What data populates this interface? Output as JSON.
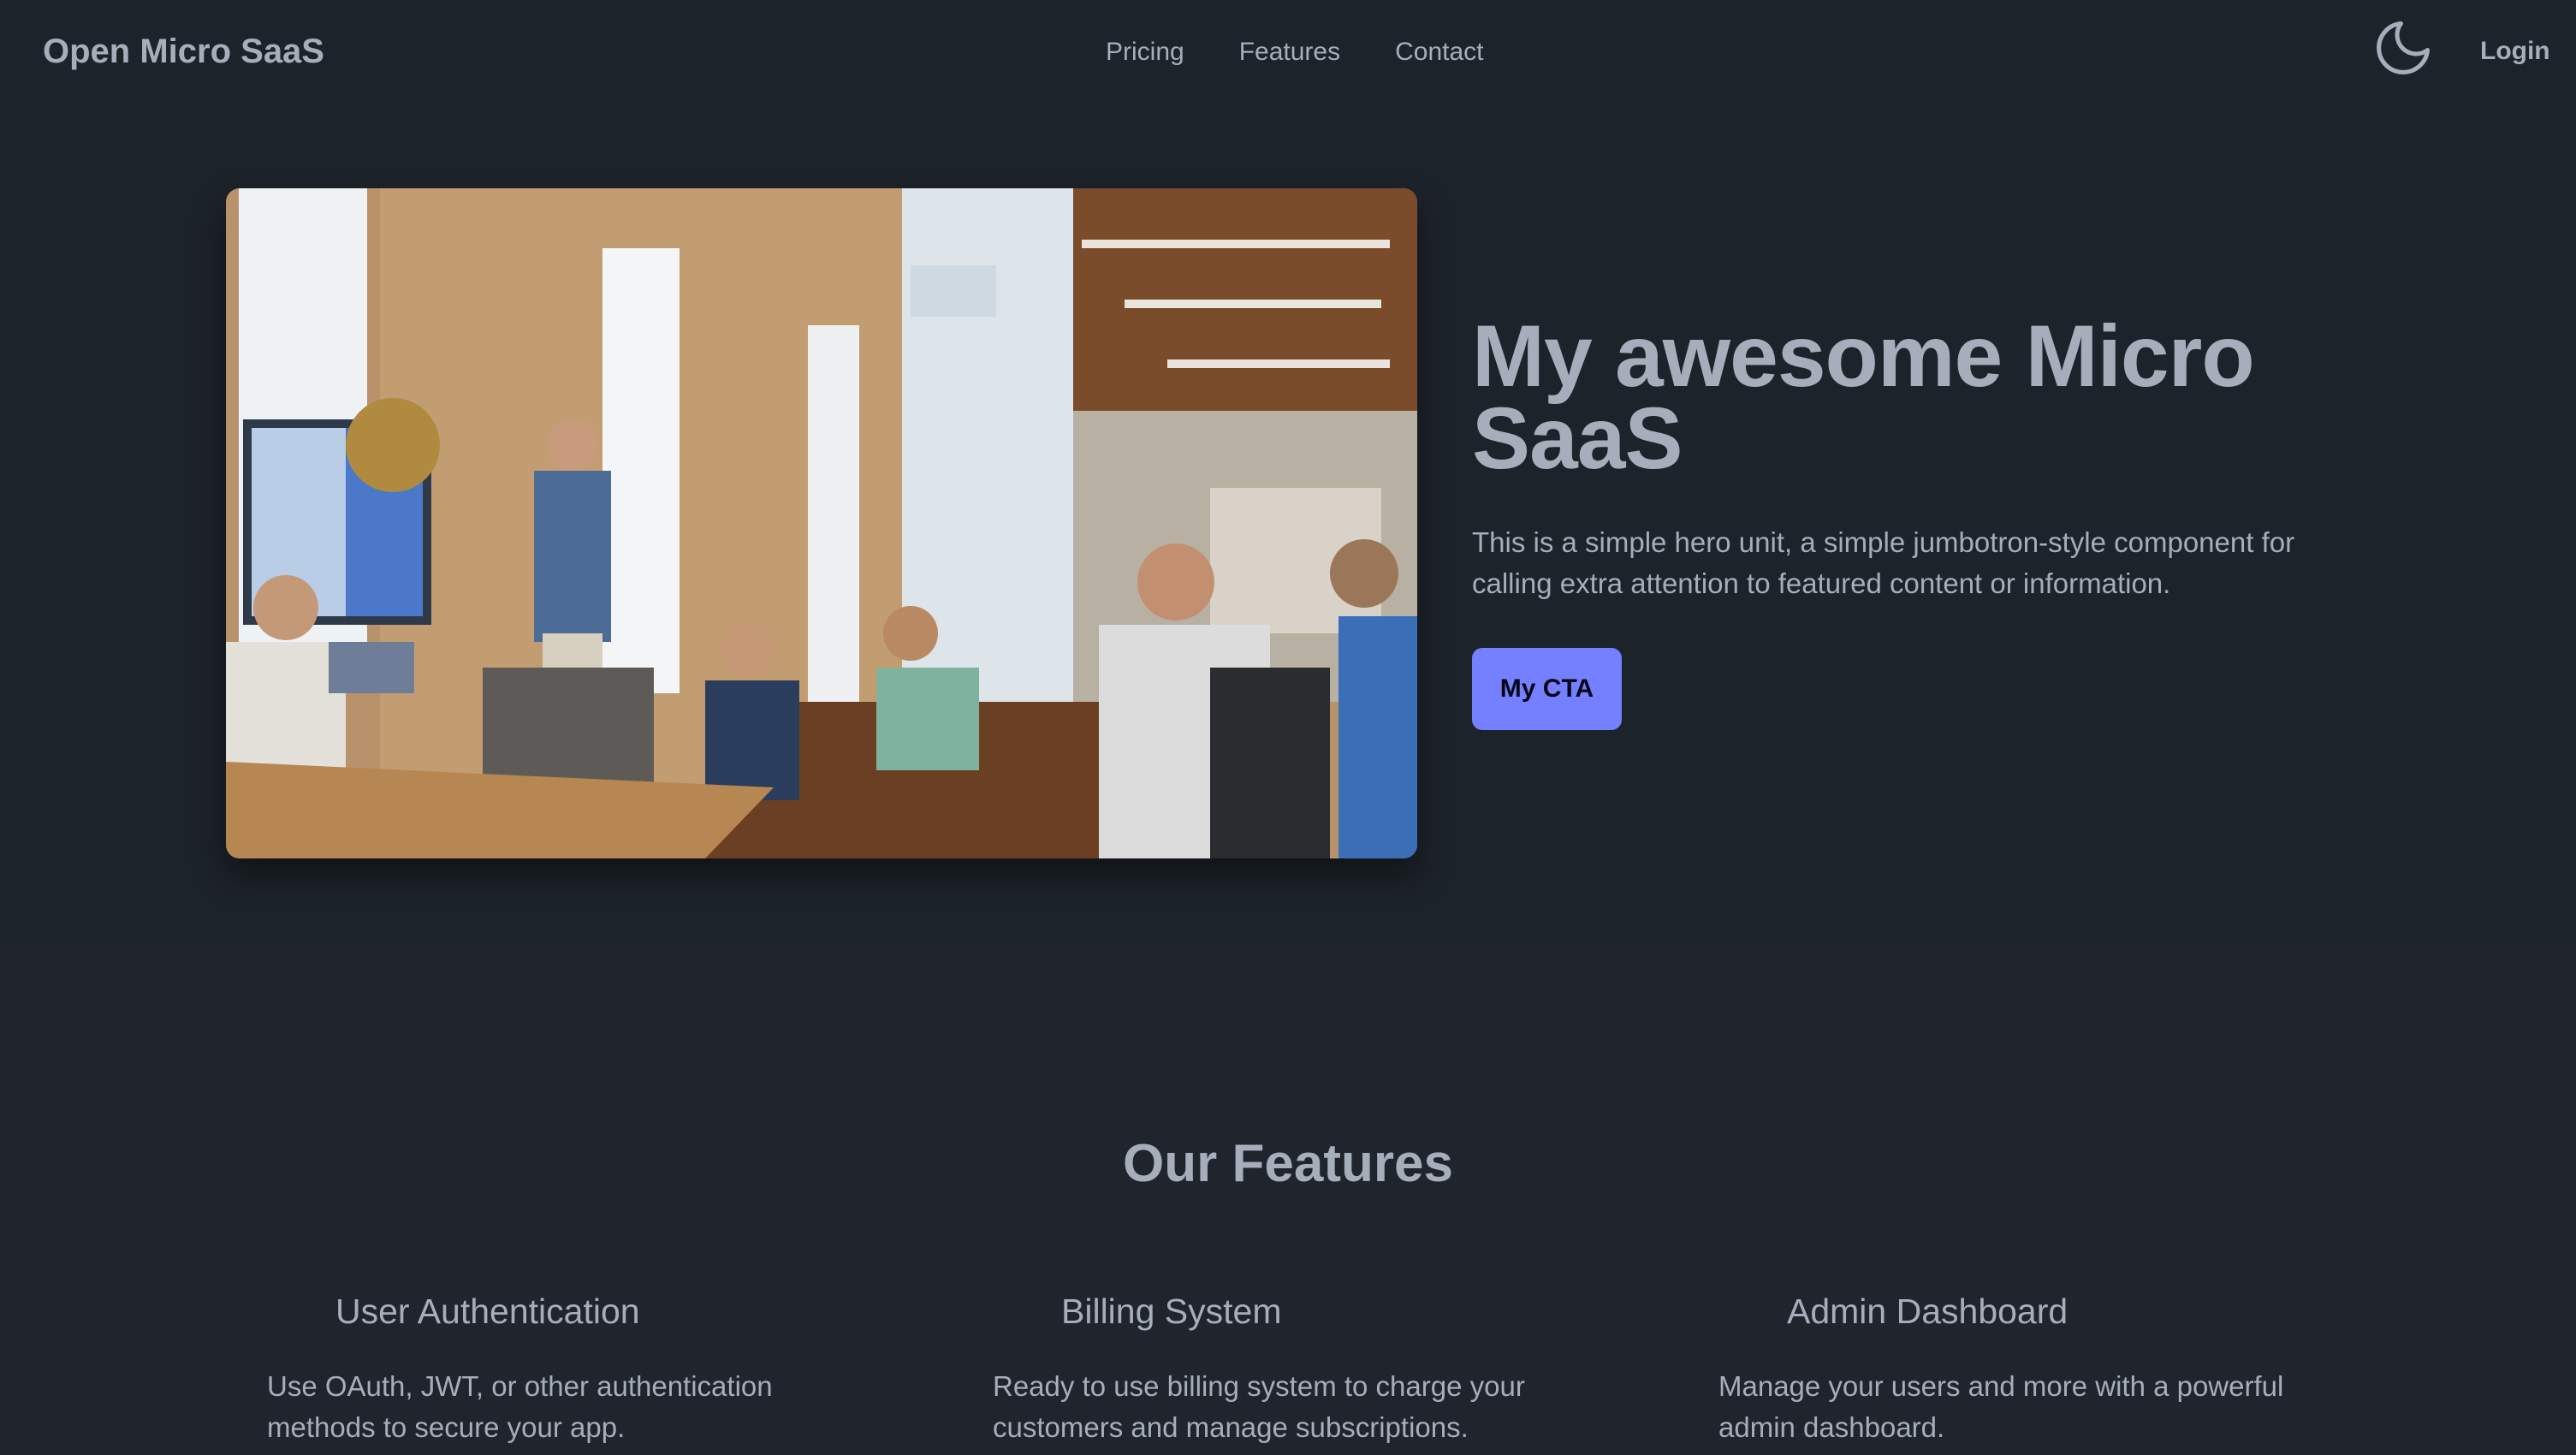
{
  "navbar": {
    "brand": "Open Micro SaaS",
    "links": [
      "Pricing",
      "Features",
      "Contact"
    ],
    "theme_icon": "moon-icon",
    "login": "Login"
  },
  "hero": {
    "image_alt": "team-meeting-photo",
    "title": "My awesome Micro SaaS",
    "text": "This is a simple hero unit, a simple jumbotron-style component for calling extra attention to featured content or information.",
    "cta": "My CTA"
  },
  "features": {
    "title": "Our Features",
    "items": [
      {
        "title": "User Authentication",
        "desc": "Use OAuth, JWT, or other authentication methods to secure your app."
      },
      {
        "title": "Billing System",
        "desc": "Ready to use billing system to charge your customers and manage subscriptions."
      },
      {
        "title": "Admin Dashboard",
        "desc": "Manage your users and more with a powerful admin dashboard."
      }
    ]
  },
  "colors": {
    "background": "#1d232a",
    "features_background": "#1f242d",
    "text": "#a6adbb",
    "primary": "#7480ff"
  }
}
